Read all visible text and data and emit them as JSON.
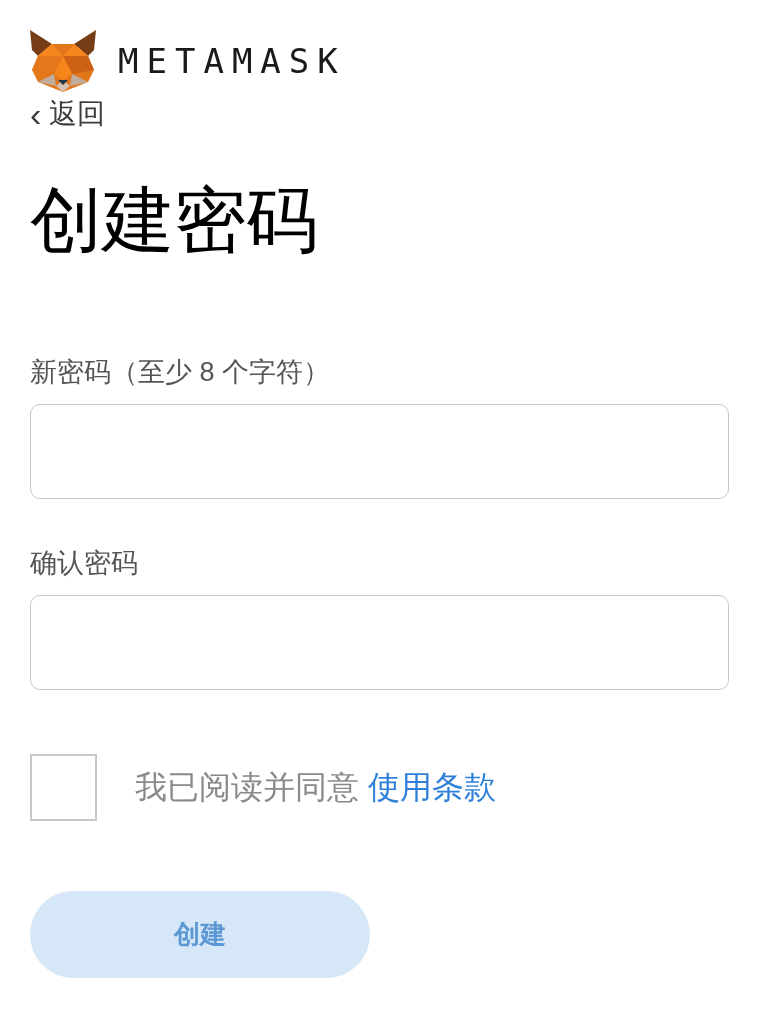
{
  "brand": {
    "wordmark": "METAMASK"
  },
  "back": {
    "icon": "‹",
    "label": "返回"
  },
  "title": "创建密码",
  "fields": [
    {
      "label": "新密码（至少 8 个字符）"
    },
    {
      "label": "确认密码"
    }
  ],
  "terms": {
    "checked": false,
    "text": "我已阅读并同意",
    "link": "使用条款"
  },
  "submit": {
    "label": "创建",
    "disabled": true
  }
}
